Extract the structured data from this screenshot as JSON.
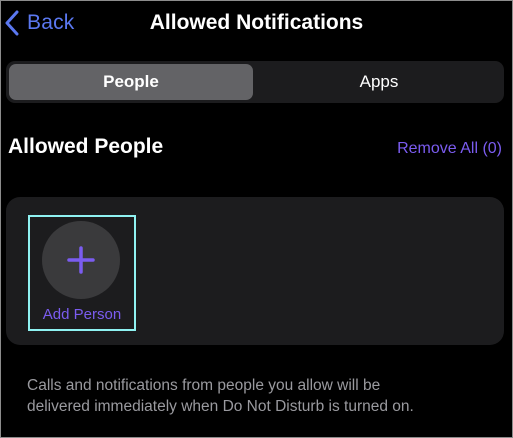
{
  "nav": {
    "back_label": "Back",
    "title": "Allowed Notifications"
  },
  "segmented": {
    "options": [
      {
        "label": "People",
        "selected": true
      },
      {
        "label": "Apps",
        "selected": false
      }
    ]
  },
  "section": {
    "title": "Allowed People",
    "remove_all_label": "Remove All (0)"
  },
  "people_list": {
    "add_person_label": "Add Person",
    "add_icon": "plus-icon"
  },
  "footnote": {
    "line1": "Calls and notifications from people you allow will be",
    "line2": "delivered immediately when Do Not Disturb is turned on."
  },
  "colors": {
    "background": "#000000",
    "accent": "#7b5cf0",
    "back_blue": "#5b78f0",
    "segmented_bg": "#1c1c1e",
    "segment_selected": "#636366",
    "highlight_outline": "#8ff2f2",
    "secondary_text": "#9a9a9f"
  }
}
